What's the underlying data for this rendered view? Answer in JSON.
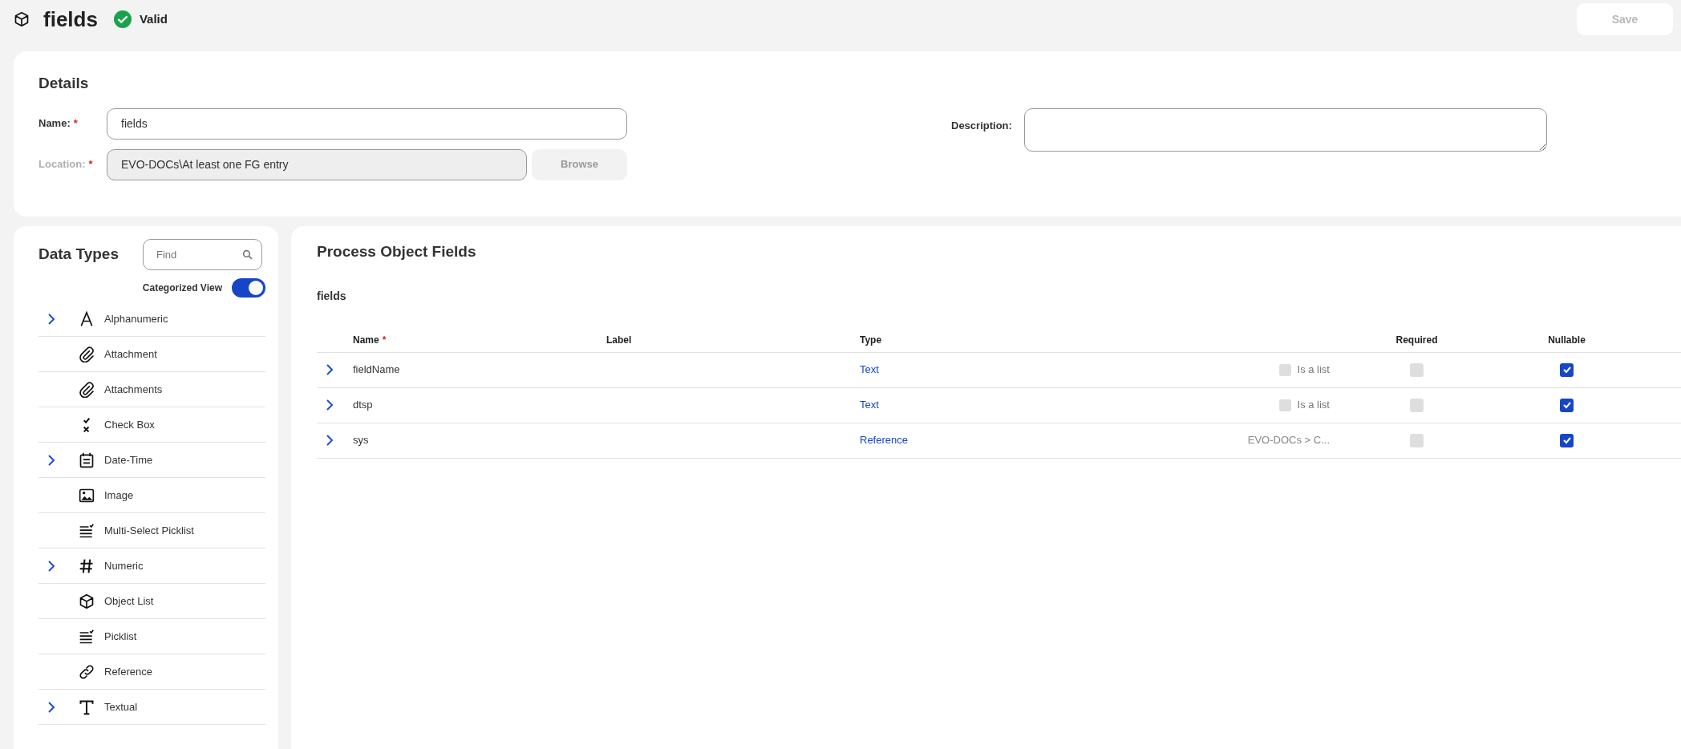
{
  "header": {
    "title": "fields",
    "status": {
      "label": "Valid",
      "valid": true
    },
    "save_button": {
      "label": "Save",
      "disabled": true
    }
  },
  "details": {
    "title": "Details",
    "name": {
      "label": "Name:",
      "required_mark": "*",
      "value": "fields"
    },
    "location": {
      "label": "Location:",
      "required_mark": "*",
      "value": "EVO-DOCs\\At least one FG entry",
      "disabled": true
    },
    "browse_button": {
      "label": "Browse",
      "disabled": true
    },
    "description": {
      "label": "Description:"
    }
  },
  "data_types": {
    "title": "Data Types",
    "search": {
      "placeholder": "Find"
    },
    "categorized_view": {
      "label": "Categorized View",
      "on": true
    },
    "items": [
      {
        "label": "Alphanumeric",
        "kind": "letter",
        "has_children": true
      },
      {
        "label": "Attachment",
        "kind": "clip",
        "has_children": false
      },
      {
        "label": "Attachments",
        "kind": "clip",
        "has_children": false
      },
      {
        "label": "Check Box",
        "kind": "checkx",
        "has_children": false
      },
      {
        "label": "Date-Time",
        "kind": "calendar",
        "has_children": true
      },
      {
        "label": "Image",
        "kind": "image",
        "has_children": false
      },
      {
        "label": "Multi-Select Picklist",
        "kind": "picklist",
        "has_children": false
      },
      {
        "label": "Numeric",
        "kind": "hash",
        "has_children": true
      },
      {
        "label": "Object List",
        "kind": "cube",
        "has_children": false
      },
      {
        "label": "Picklist",
        "kind": "picklist",
        "has_children": false
      },
      {
        "label": "Reference",
        "kind": "link",
        "has_children": false
      },
      {
        "label": "Textual",
        "kind": "serif-t",
        "has_children": true
      }
    ]
  },
  "process_object_fields": {
    "title": "Process Object Fields",
    "group": "fields",
    "columns": [
      {
        "label": "Name",
        "required_mark": "*"
      },
      {
        "label": "Label"
      },
      {
        "label": "Type"
      },
      {
        "label": "Required"
      },
      {
        "label": "Nullable"
      }
    ],
    "rows": [
      {
        "name": "fieldName",
        "type": "Text",
        "extra": {
          "kind": "list_checkbox",
          "label": "Is a list",
          "checked": false
        },
        "required": false,
        "nullable": true
      },
      {
        "name": "dtsp",
        "type": "Text",
        "extra": {
          "kind": "list_checkbox",
          "label": "Is a list",
          "checked": false
        },
        "required": false,
        "nullable": true
      },
      {
        "name": "sys",
        "type": "Reference",
        "extra": {
          "kind": "path",
          "text": "EVO-DOCs > C..."
        },
        "required": false,
        "nullable": true
      }
    ]
  }
}
